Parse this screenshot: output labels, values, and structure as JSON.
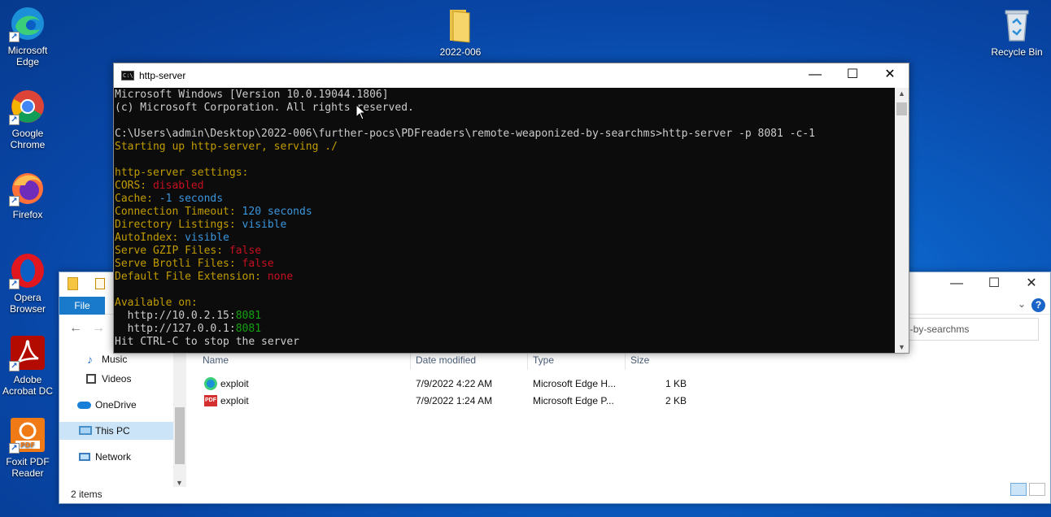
{
  "desktop": {
    "icons": [
      {
        "label": "Microsoft Edge"
      },
      {
        "label": "Google Chrome"
      },
      {
        "label": "Firefox"
      },
      {
        "label": "Opera Browser"
      },
      {
        "label": "Adobe Acrobat DC"
      },
      {
        "label": "Foxit PDF Reader"
      },
      {
        "label": "2022-006"
      },
      {
        "label": "Recycle Bin"
      }
    ]
  },
  "console": {
    "title": "http-server",
    "lines": [
      [
        {
          "t": "Microsoft Windows [Version 10.0.19044.1806]",
          "c": "w"
        }
      ],
      [
        {
          "t": "(c) Microsoft Corporation. All rights reserved.",
          "c": "w"
        }
      ],
      [],
      [
        {
          "t": "C:\\Users\\admin\\Desktop\\2022-006\\further-pocs\\PDFreaders\\remote-weaponized-by-searchms>http-server -p 8081 -c-1",
          "c": "w"
        }
      ],
      [
        {
          "t": "Starting up http-server, serving ./",
          "c": "y"
        }
      ],
      [],
      [
        {
          "t": "http-server settings:",
          "c": "y"
        }
      ],
      [
        {
          "t": "CORS: ",
          "c": "y"
        },
        {
          "t": "disabled",
          "c": "r"
        }
      ],
      [
        {
          "t": "Cache: ",
          "c": "y"
        },
        {
          "t": "-1 seconds",
          "c": "b"
        }
      ],
      [
        {
          "t": "Connection Timeout: ",
          "c": "y"
        },
        {
          "t": "120 seconds",
          "c": "b"
        }
      ],
      [
        {
          "t": "Directory Listings: ",
          "c": "y"
        },
        {
          "t": "visible",
          "c": "b"
        }
      ],
      [
        {
          "t": "AutoIndex: ",
          "c": "y"
        },
        {
          "t": "visible",
          "c": "b"
        }
      ],
      [
        {
          "t": "Serve GZIP Files: ",
          "c": "y"
        },
        {
          "t": "false",
          "c": "r"
        }
      ],
      [
        {
          "t": "Serve Brotli Files: ",
          "c": "y"
        },
        {
          "t": "false",
          "c": "r"
        }
      ],
      [
        {
          "t": "Default File Extension: ",
          "c": "y"
        },
        {
          "t": "none",
          "c": "r"
        }
      ],
      [],
      [
        {
          "t": "Available on:",
          "c": "y"
        }
      ],
      [
        {
          "t": "  http://10.0.2.15:",
          "c": "w"
        },
        {
          "t": "8081",
          "c": "g"
        }
      ],
      [
        {
          "t": "  http://127.0.0.1:",
          "c": "w"
        },
        {
          "t": "8081",
          "c": "g"
        }
      ],
      [
        {
          "t": "Hit CTRL-C to stop the server",
          "c": "w"
        }
      ]
    ]
  },
  "explorer": {
    "file_tab": "File",
    "search_placeholder": "d-by-searchms",
    "help": "?",
    "nav": {
      "music": "Music",
      "videos": "Videos",
      "onedrive": "OneDrive",
      "thispc": "This PC",
      "network": "Network"
    },
    "columns": {
      "name": "Name",
      "date": "Date modified",
      "type": "Type",
      "size": "Size"
    },
    "files": [
      {
        "name": "exploit",
        "date": "7/9/2022 4:22 AM",
        "type": "Microsoft Edge H...",
        "size": "1 KB"
      },
      {
        "name": "exploit",
        "date": "7/9/2022 1:24 AM",
        "type": "Microsoft Edge P...",
        "size": "2 KB"
      }
    ],
    "status": "2 items"
  },
  "colors": {
    "accent": "#1979ca",
    "console_bg": "#0c0c0c",
    "console_yellow": "#c19c00",
    "console_red": "#c50f1f",
    "console_blue": "#3a96dd",
    "console_green": "#13a10e"
  }
}
